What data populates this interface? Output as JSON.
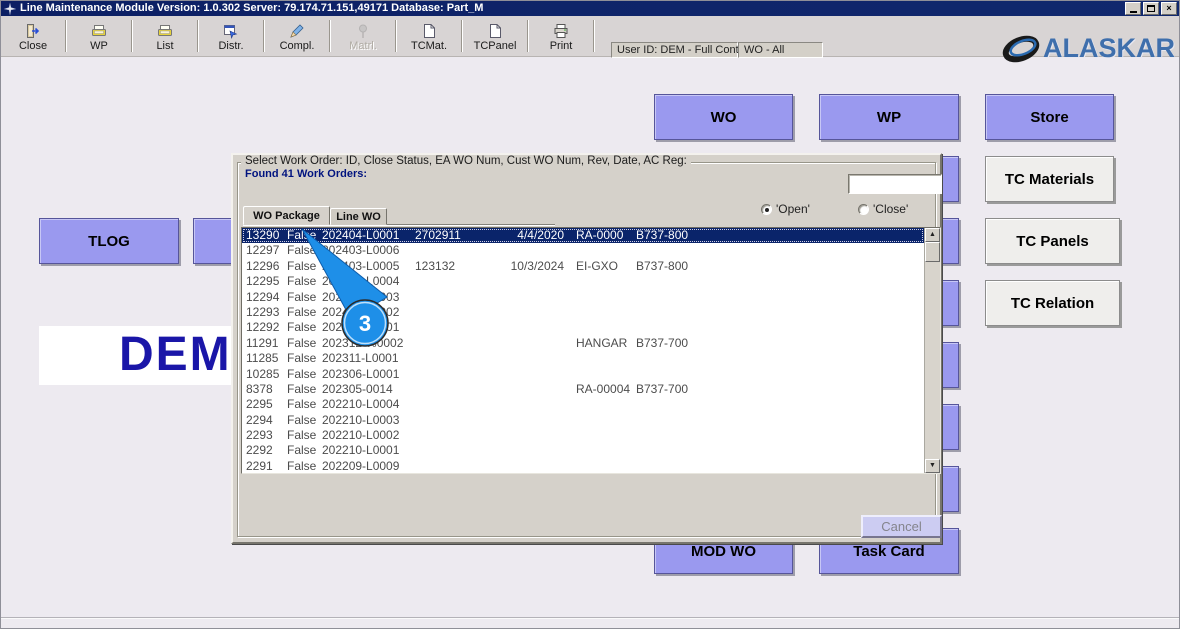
{
  "window": {
    "title": "Line Maintenance Module  Version: 1.0.302 Server: 79.174.71.151,49171 Database: Part_M"
  },
  "toolbar": {
    "buttons": [
      {
        "label": "Close",
        "icon": "exit-door-icon",
        "disabled": false
      },
      {
        "label": "WP",
        "icon": "wp-device-icon",
        "disabled": false
      },
      {
        "label": "List",
        "icon": "list-device-icon",
        "disabled": false
      },
      {
        "label": "Distr.",
        "icon": "distribute-window-icon",
        "disabled": false
      },
      {
        "label": "Compl.",
        "icon": "complete-pen-icon",
        "disabled": false
      },
      {
        "label": "Matrl.",
        "icon": "material-pin-icon",
        "disabled": true
      },
      {
        "label": "TCMat.",
        "icon": "document-icon",
        "disabled": false
      },
      {
        "label": "TCPanel",
        "icon": "document-icon",
        "disabled": false
      },
      {
        "label": "Print",
        "icon": "printer-icon",
        "disabled": false
      }
    ],
    "user_panel": "User ID: DEM - Full Control",
    "scope_panel": "WO - All",
    "logo_text": "ALASKAR"
  },
  "main": {
    "buttons": {
      "wo": "WO",
      "wp": "WP",
      "store": "Store",
      "tc_materials": "TC Materials",
      "tlog": "TLOG",
      "tc_panels": "TC Panels",
      "tc_relation": "TC Relation",
      "mod_wo": "MOD WO",
      "task_card": "Task Card"
    },
    "dem_text": "DEM"
  },
  "dialog": {
    "group_title": "Select Work Order: ID, Close Status, EA WO Num, Cust WO Num, Rev, Date, AC Reg:",
    "found_label": "Found 41 Work Orders:",
    "search_value": "",
    "tabs": [
      {
        "label": "WO Package",
        "active": true
      },
      {
        "label": "Line WO",
        "active": false
      }
    ],
    "radios": [
      {
        "label": "'Open'",
        "selected": true
      },
      {
        "label": "'Close'",
        "selected": false
      }
    ],
    "rows": [
      {
        "id": "13290",
        "close_status": "False",
        "ea_wo_num": "202404-L0001",
        "cust_wo_num": "2702911",
        "date": "4/4/2020",
        "ac_reg": "RA-0000",
        "ac_type": "B737-800",
        "selected": true
      },
      {
        "id": "12297",
        "close_status": "False",
        "ea_wo_num": "202403-L0006",
        "cust_wo_num": "",
        "date": "",
        "ac_reg": "",
        "ac_type": "",
        "selected": false
      },
      {
        "id": "12296",
        "close_status": "False",
        "ea_wo_num": "202403-L0005",
        "cust_wo_num": "123132",
        "date": "10/3/2024",
        "ac_reg": "EI-GXO",
        "ac_type": "B737-800",
        "selected": false
      },
      {
        "id": "12295",
        "close_status": "False",
        "ea_wo_num": "202403-L0004",
        "cust_wo_num": "",
        "date": "",
        "ac_reg": "",
        "ac_type": "",
        "selected": false
      },
      {
        "id": "12294",
        "close_status": "False",
        "ea_wo_num": "202403-L0003",
        "cust_wo_num": "",
        "date": "",
        "ac_reg": "",
        "ac_type": "",
        "selected": false
      },
      {
        "id": "12293",
        "close_status": "False",
        "ea_wo_num": "202403-L0002",
        "cust_wo_num": "",
        "date": "",
        "ac_reg": "",
        "ac_type": "",
        "selected": false
      },
      {
        "id": "12292",
        "close_status": "False",
        "ea_wo_num": "202403-L0001",
        "cust_wo_num": "",
        "date": "",
        "ac_reg": "",
        "ac_type": "",
        "selected": false
      },
      {
        "id": "11291",
        "close_status": "False",
        "ea_wo_num": "202312-%0002",
        "cust_wo_num": "",
        "date": "",
        "ac_reg": "HANGAR",
        "ac_type": "B737-700",
        "selected": false
      },
      {
        "id": "11285",
        "close_status": "False",
        "ea_wo_num": "202311-L0001",
        "cust_wo_num": "",
        "date": "",
        "ac_reg": "",
        "ac_type": "",
        "selected": false
      },
      {
        "id": "10285",
        "close_status": "False",
        "ea_wo_num": "202306-L0001",
        "cust_wo_num": "",
        "date": "",
        "ac_reg": "",
        "ac_type": "",
        "selected": false
      },
      {
        "id": "8378",
        "close_status": "False",
        "ea_wo_num": "202305-0014",
        "cust_wo_num": "",
        "date": "",
        "ac_reg": "RA-00004",
        "ac_type": "B737-700",
        "selected": false
      },
      {
        "id": "2295",
        "close_status": "False",
        "ea_wo_num": "202210-L0004",
        "cust_wo_num": "",
        "date": "",
        "ac_reg": "",
        "ac_type": "",
        "selected": false
      },
      {
        "id": "2294",
        "close_status": "False",
        "ea_wo_num": "202210-L0003",
        "cust_wo_num": "",
        "date": "",
        "ac_reg": "",
        "ac_type": "",
        "selected": false
      },
      {
        "id": "2293",
        "close_status": "False",
        "ea_wo_num": "202210-L0002",
        "cust_wo_num": "",
        "date": "",
        "ac_reg": "",
        "ac_type": "",
        "selected": false
      },
      {
        "id": "2292",
        "close_status": "False",
        "ea_wo_num": "202210-L0001",
        "cust_wo_num": "",
        "date": "",
        "ac_reg": "",
        "ac_type": "",
        "selected": false
      },
      {
        "id": "2291",
        "close_status": "False",
        "ea_wo_num": "202209-L0009",
        "cust_wo_num": "",
        "date": "",
        "ac_reg": "",
        "ac_type": "",
        "selected": false
      }
    ],
    "cancel_label": "Cancel"
  },
  "annotation": {
    "step": "3"
  },
  "colors": {
    "titlebar": "#0c1f64",
    "button_accent": "#9a99ef",
    "selected_row": "#0a246a",
    "annotation_blue": "#1e8fe8",
    "dialog_bg": "#d5d1ca",
    "logo_blue": "#3f6fac"
  }
}
